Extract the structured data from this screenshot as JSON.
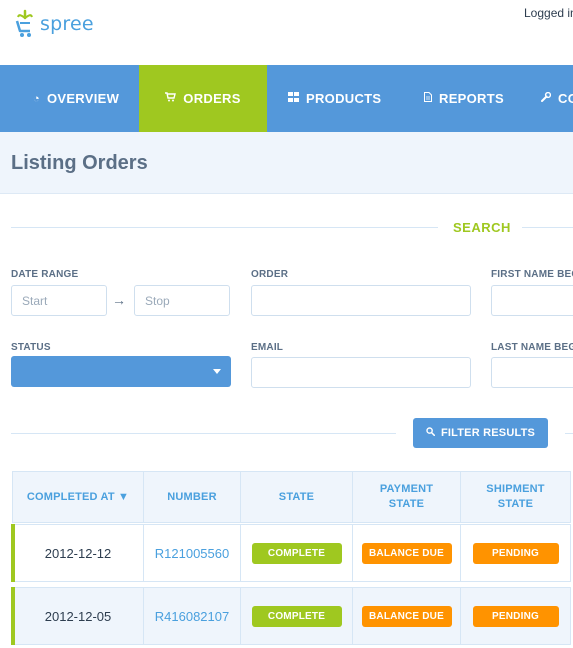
{
  "brand": {
    "name": "spree"
  },
  "header": {
    "logged_in_text": "Logged in"
  },
  "nav": {
    "items": [
      {
        "label": "OVERVIEW",
        "icon": "dashboard-icon"
      },
      {
        "label": "ORDERS",
        "icon": "cart-icon",
        "active": true
      },
      {
        "label": "PRODUCTS",
        "icon": "grid-icon"
      },
      {
        "label": "REPORTS",
        "icon": "file-icon"
      },
      {
        "label": "CO",
        "icon": "wrench-icon"
      }
    ]
  },
  "page": {
    "title": "Listing Orders"
  },
  "search": {
    "section_label": "SEARCH",
    "date_range_label": "DATE RANGE",
    "start_placeholder": "Start",
    "stop_placeholder": "Stop",
    "order_label": "ORDER",
    "first_name_label": "FIRST NAME BEG",
    "status_label": "STATUS",
    "status_value": "",
    "email_label": "EMAIL",
    "last_name_label": "LAST NAME BEG",
    "filter_button": "FILTER RESULTS"
  },
  "table": {
    "headers": {
      "completed_at": "COMPLETED AT ▼",
      "number": "NUMBER",
      "state": "STATE",
      "payment_state": "PAYMENT STATE",
      "shipment_state": "SHIPMENT STATE"
    },
    "rows": [
      {
        "completed_at": "2012-12-12",
        "number": "R121005560",
        "state": "COMPLETE",
        "payment_state": "BALANCE DUE",
        "shipment_state": "PENDING"
      },
      {
        "completed_at": "2012-12-05",
        "number": "R416082107",
        "state": "COMPLETE",
        "payment_state": "BALANCE DUE",
        "shipment_state": "PENDING"
      }
    ]
  },
  "colors": {
    "primary": "#5498da",
    "accent": "#9fc820",
    "warning": "#ff9300",
    "text": "#5b6f86",
    "band": "#eff5fc"
  }
}
